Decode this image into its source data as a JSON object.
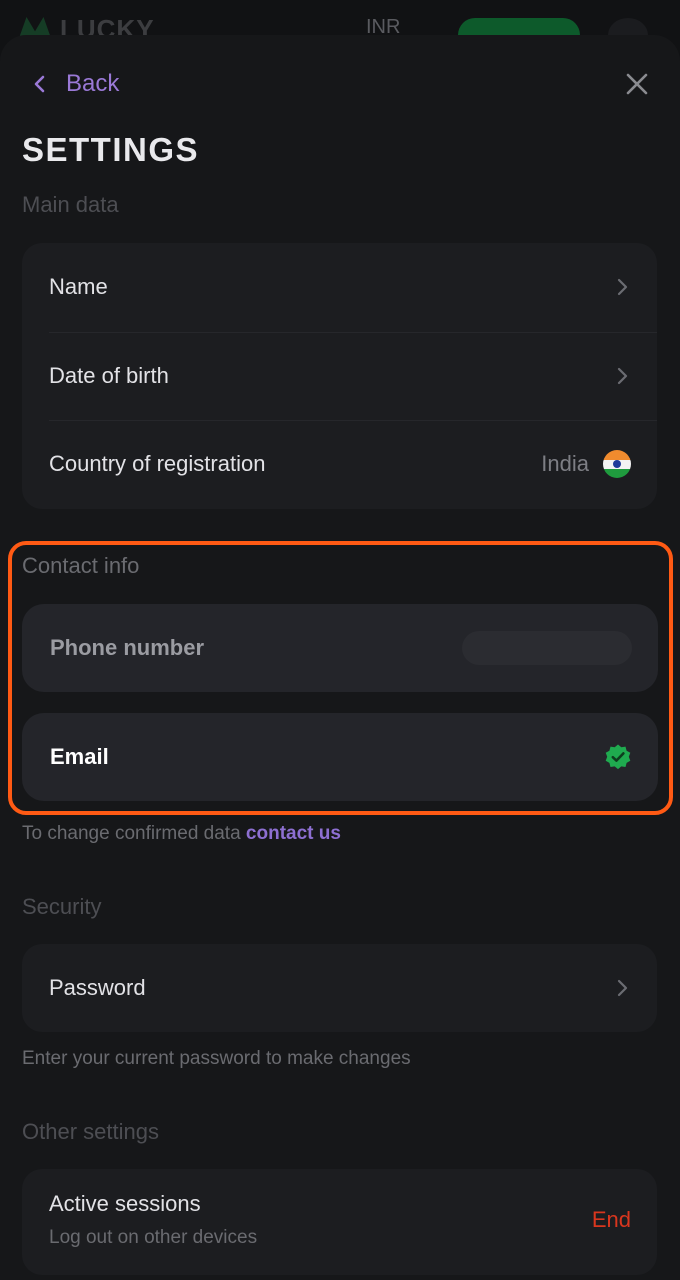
{
  "background": {
    "logo_text": "LUCKY",
    "currency": "INR"
  },
  "nav": {
    "back_label": "Back"
  },
  "page_title": "SETTINGS",
  "main_data": {
    "section_label": "Main data",
    "rows": [
      {
        "label": "Name"
      },
      {
        "label": "Date of birth"
      },
      {
        "label": "Country of registration",
        "value": "India"
      }
    ]
  },
  "contact_info": {
    "section_label": "Contact info",
    "phone_label": "Phone number",
    "email_label": "Email",
    "note_text": "To change confirmed data",
    "note_link": "contact us"
  },
  "security": {
    "section_label": "Security",
    "password_label": "Password",
    "note_text": "Enter your current password to make changes"
  },
  "other_settings": {
    "section_label": "Other settings",
    "sessions_title": "Active sessions",
    "sessions_subtitle": "Log out on other devices",
    "end_label": "End"
  },
  "colors": {
    "accent": "#9a79d6",
    "highlight": "#ff5a14",
    "verified": "#1faa4f",
    "danger": "#d9361e"
  }
}
